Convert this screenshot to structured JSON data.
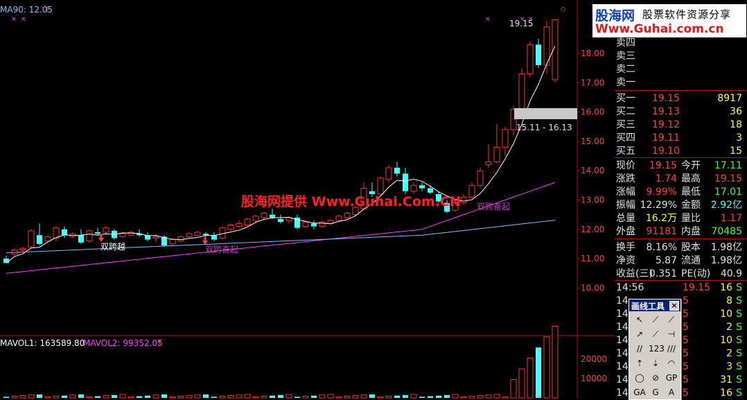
{
  "top_indicator": "MA90: 12.05",
  "price_axis": [
    "18.00",
    "17.00",
    "16.00",
    "15.00",
    "14.00",
    "13.00",
    "12.00",
    "11.00",
    "10.00"
  ],
  "volume_axis": [
    "20000",
    "10000"
  ],
  "annotations": {
    "peak_price": "19.15",
    "range_box": "15.11 - 16.13",
    "cross1": "双跨越",
    "rise1": "双跨奋起",
    "rise2": "双跨奋起"
  },
  "volume_header": {
    "mavol1": "MAVOL1: 163589.80",
    "mavol2": "MAVOL2: 99352.05"
  },
  "watermark": {
    "brand": "股海网",
    "tagline": "股票软件资源分享",
    "url": "Www.Guhai.com.cn",
    "center": "股海网提供 Www.Guhai.Com.CN"
  },
  "sell_levels": [
    "卖四",
    "卖三",
    "卖二",
    "卖一"
  ],
  "buy_levels": [
    {
      "label": "买一",
      "price": "19.15",
      "vol": "8917"
    },
    {
      "label": "买二",
      "price": "19.13",
      "vol": "36"
    },
    {
      "label": "买三",
      "price": "19.12",
      "vol": "18"
    },
    {
      "label": "买四",
      "price": "19.11",
      "vol": "3"
    },
    {
      "label": "买五",
      "price": "19.10",
      "vol": "15"
    }
  ],
  "quote": [
    {
      "l1": "现价",
      "v1": "19.15",
      "c1": "red",
      "l2": "今开",
      "v2": "17.11",
      "c2": "green"
    },
    {
      "l1": "涨跌",
      "v1": "1.74",
      "c1": "red",
      "l2": "最高",
      "v2": "19.15",
      "c2": "red"
    },
    {
      "l1": "涨幅",
      "v1": "9.99%",
      "c1": "red",
      "l2": "最低",
      "v2": "17.01",
      "c2": "green"
    },
    {
      "l1": "振幅",
      "v1": "12.29%",
      "c1": "lbl",
      "l2": "金额",
      "v2": "2.92亿",
      "c2": "cyan"
    },
    {
      "l1": "总量",
      "v1": "16.2万",
      "c1": "yellow",
      "l2": "量比",
      "v2": "1.17",
      "c2": "red"
    },
    {
      "l1": "外盘",
      "v1": "91181",
      "c1": "red",
      "l2": "内盘",
      "v2": "70485",
      "c2": "green"
    },
    {
      "l1": "换手",
      "v1": "8.16%",
      "c1": "lbl",
      "l2": "股本",
      "v2": "1.98亿",
      "c2": "lbl"
    },
    {
      "l1": "净资",
      "v1": "5.87",
      "c1": "lbl",
      "l2": "流通",
      "v2": "1.98亿",
      "c2": "lbl"
    },
    {
      "l1": "收益(三)",
      "v1": "0.351",
      "c1": "lbl",
      "l2": "PE(动)",
      "v2": "40.9",
      "c2": "lbl"
    }
  ],
  "ticks": [
    {
      "time": "14:56",
      "price": "19.15",
      "vol": "16",
      "side": "S"
    },
    {
      "time": "14:",
      "price": "5",
      "vol": "8",
      "side": "S"
    },
    {
      "time": "14:",
      "price": "5",
      "vol": "10",
      "side": "S"
    },
    {
      "time": "14:",
      "price": "5",
      "vol": "2",
      "side": "S"
    },
    {
      "time": "14:",
      "price": "5",
      "vol": "10",
      "side": "S"
    },
    {
      "time": "14:",
      "price": "5",
      "vol": "2",
      "side": "S"
    },
    {
      "time": "14:",
      "price": "5",
      "vol": "3",
      "side": "S"
    },
    {
      "time": "14:",
      "price": "5",
      "vol": "31",
      "side": "S"
    },
    {
      "time": "14:",
      "price": "5",
      "vol": "16",
      "side": "S"
    }
  ],
  "toolbox": {
    "title": "画线工具",
    "close": "×",
    "tools": [
      "pointer",
      "segment",
      "line",
      "arrow",
      "ray",
      "horizontal-line",
      "channel",
      "fib-numbers",
      "parallel",
      "up-arrow",
      "down-arrow",
      "arc",
      "circle",
      "angle",
      "gold-percent",
      "gold-angle",
      "gold-spiral",
      "text"
    ],
    "glyphs": [
      "↖",
      "⟋",
      "⟋",
      "↗",
      "⟋",
      "⊣",
      "//",
      "123",
      "///",
      "⇡",
      "⇣",
      "◠",
      "◯",
      "⊘",
      "GP",
      "GA",
      "G",
      "A"
    ]
  },
  "colors": {
    "up": "#ff3030",
    "down": "#40ffff",
    "ma1": "#ffffff",
    "ma2": "#ff40ff",
    "ma3": "#80c0ff"
  }
}
